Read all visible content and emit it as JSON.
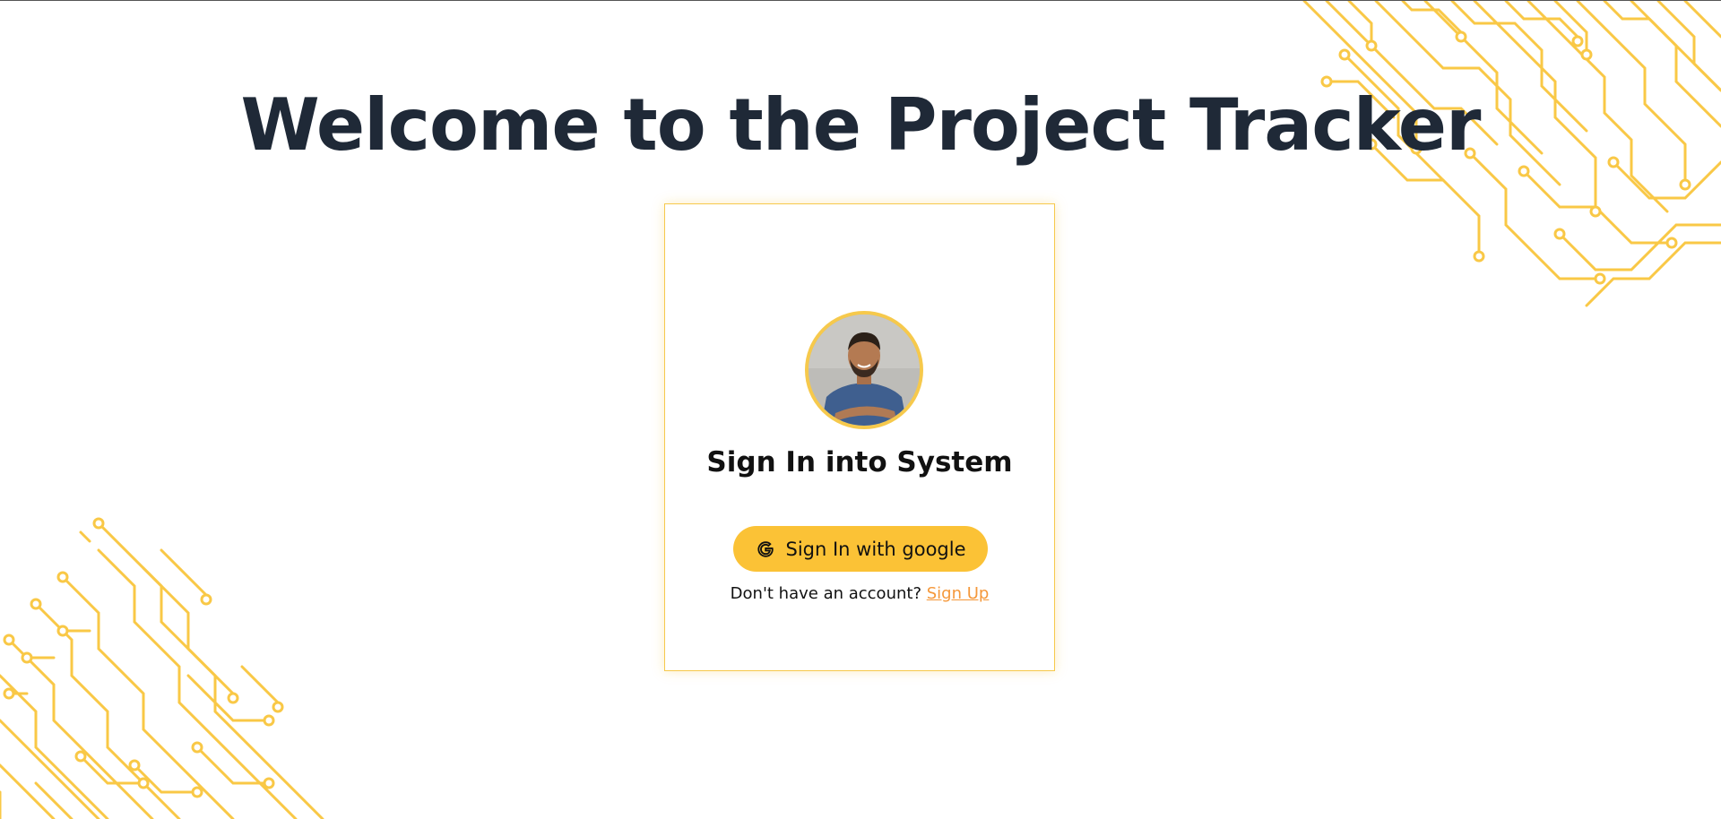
{
  "page": {
    "title": "Welcome to the Project Tracker"
  },
  "card": {
    "heading": "Sign In into System",
    "google_button_label": "Sign In with google",
    "signup_prompt": "Don't have an account?",
    "signup_link": "Sign Up"
  },
  "icons": {
    "avatar": "user-avatar-photo",
    "google": "google-g-icon",
    "decor": "circuit-pattern"
  },
  "colors": {
    "accent": "#fbc236",
    "card_border": "#f6c94c",
    "title_text": "#1f2937",
    "link": "#f5983a",
    "circuit": "#f9c846"
  }
}
